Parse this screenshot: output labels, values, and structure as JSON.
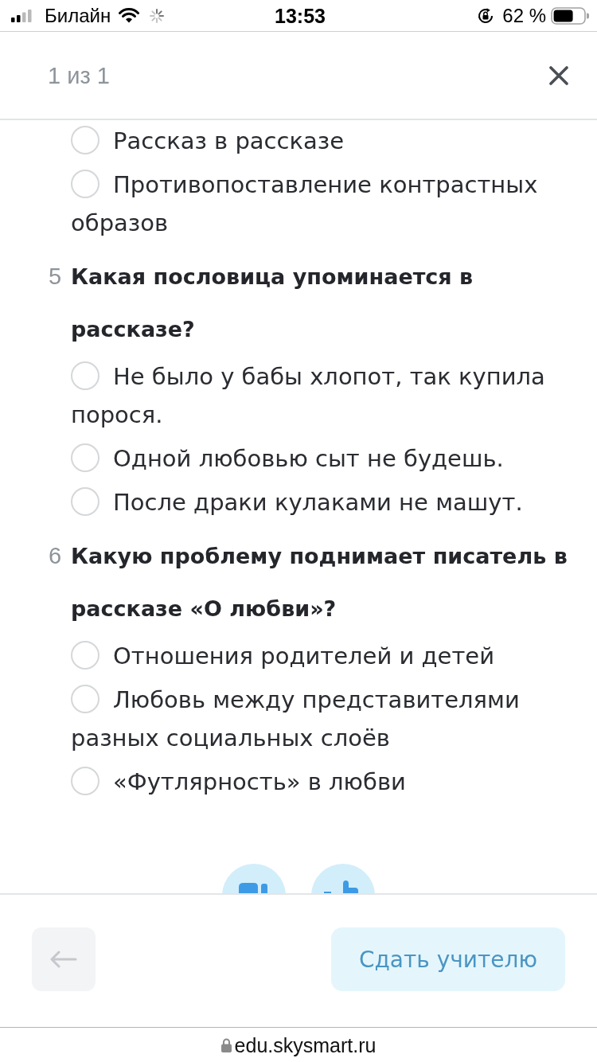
{
  "status_bar": {
    "carrier": "Билайн",
    "time": "13:53",
    "battery": "62 %"
  },
  "header": {
    "counter": "1 из 1"
  },
  "questions": [
    {
      "options": [
        {
          "text": "Рассказ в рассказе",
          "selected": false
        },
        {
          "text": "Противопоставление контрастных образов",
          "selected": false
        }
      ]
    },
    {
      "number": "5",
      "text": "Какая пословица упоминается в рассказе?",
      "options": [
        {
          "text": "Не было у бабы хлопот, так купила порося.",
          "selected": false
        },
        {
          "text": "Одной любовью сыт не будешь.",
          "selected": false
        },
        {
          "text": "После драки кулаками не машут.",
          "selected": false
        }
      ]
    },
    {
      "number": "6",
      "text": "Какую проблему поднимает писатель в рассказе «О любви»?",
      "options": [
        {
          "text": "Отношения родителей и детей",
          "selected": false
        },
        {
          "text": "Любовь между представителями разных социальных слоёв",
          "selected": false
        },
        {
          "text": "«Футлярность» в любви",
          "selected": false
        }
      ]
    }
  ],
  "footer": {
    "back_button": {
      "disabled": true
    },
    "submit_button": {
      "label": "Сдать учителю"
    }
  },
  "address_bar": {
    "url": "edu.skysmart.ru"
  }
}
